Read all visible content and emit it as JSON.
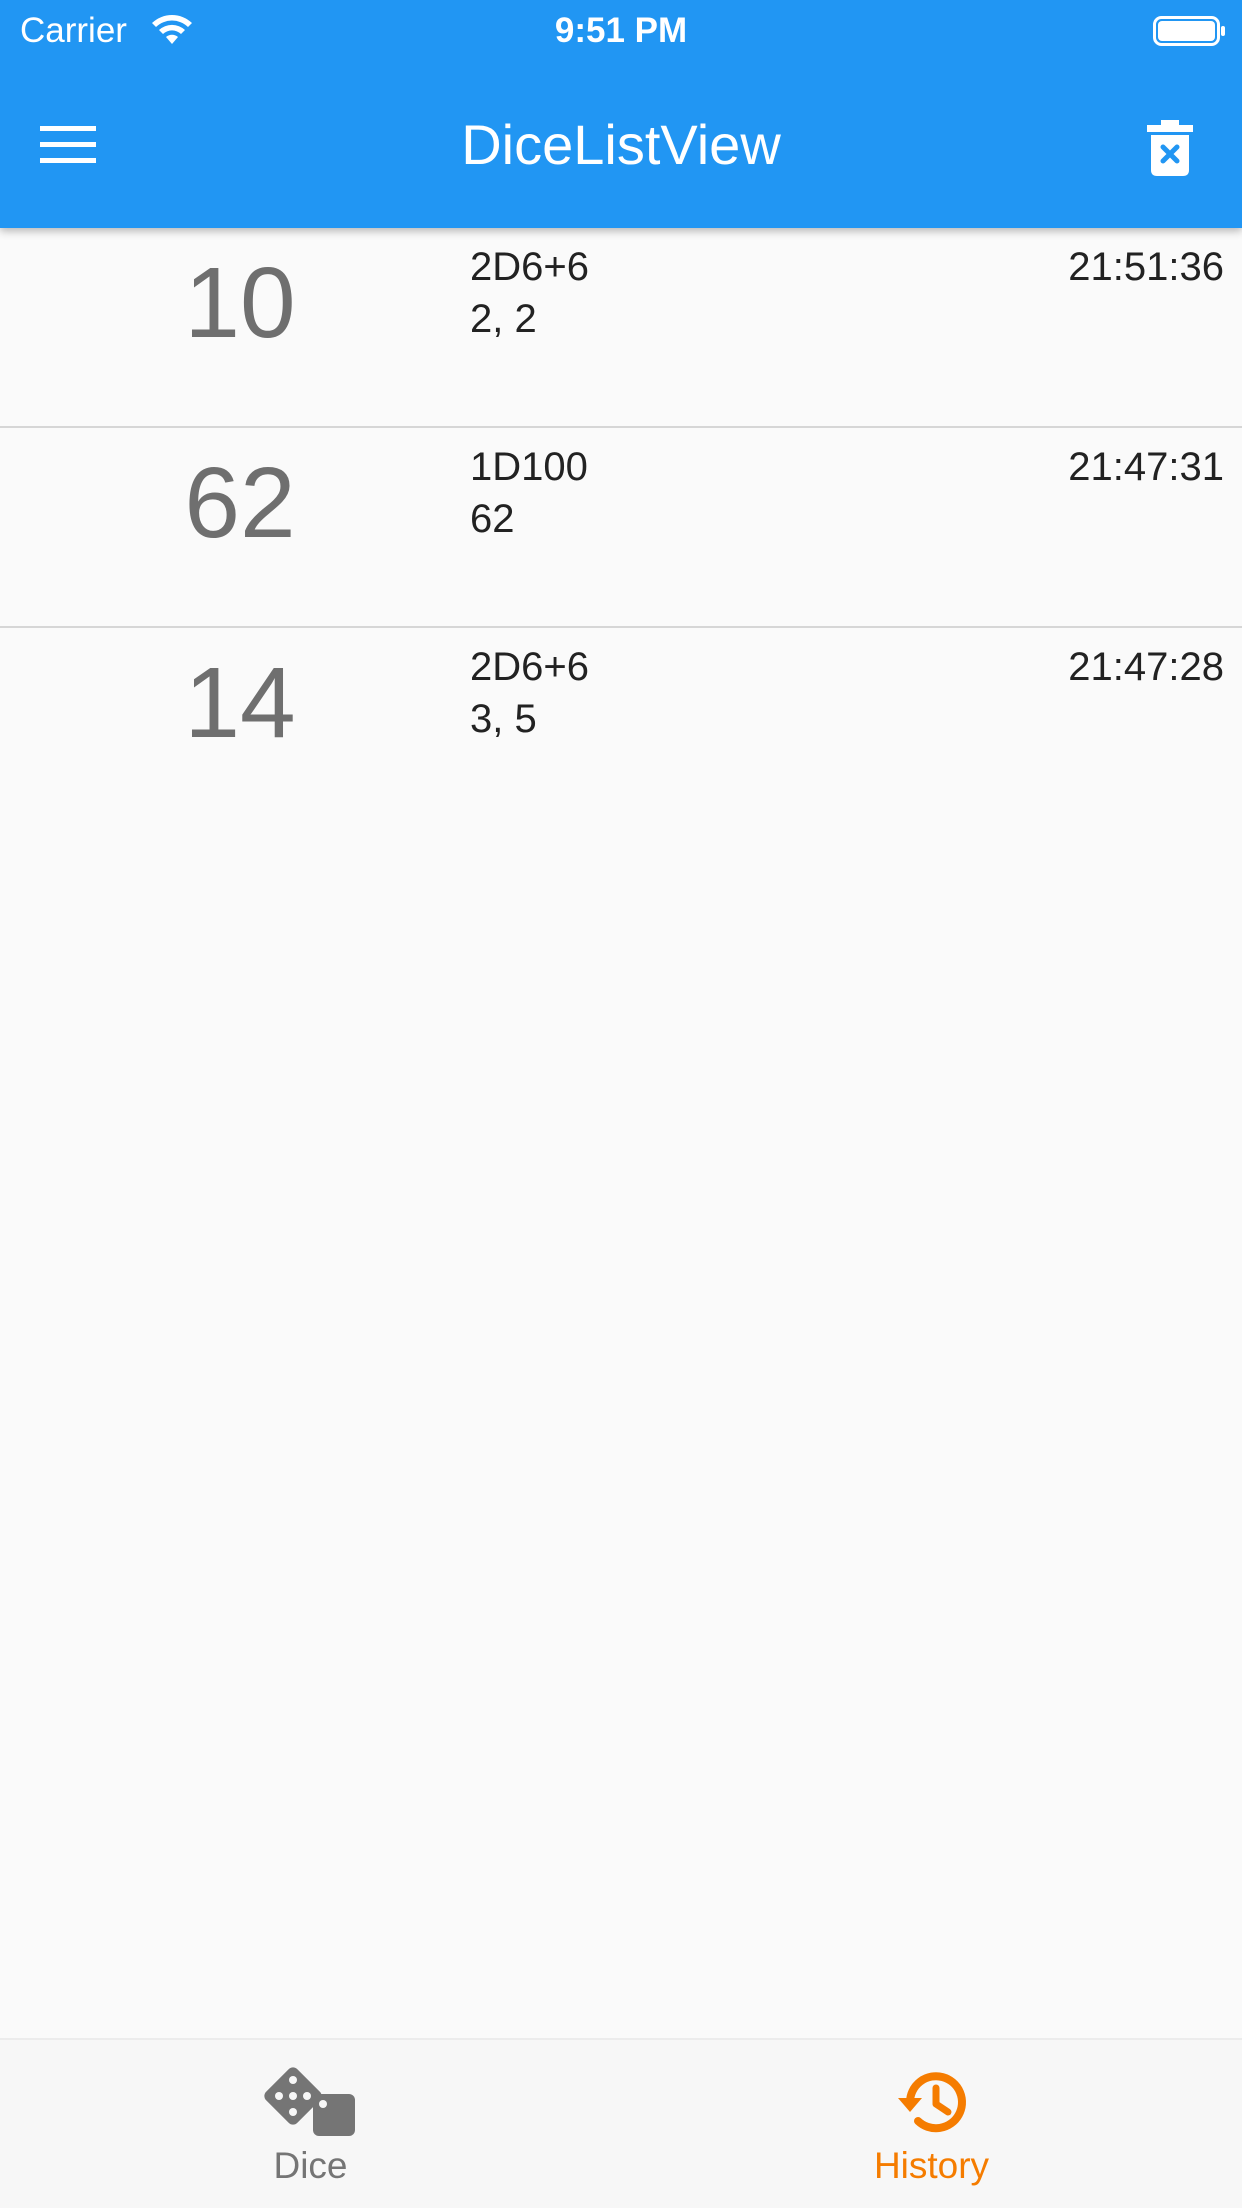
{
  "status_bar": {
    "carrier": "Carrier",
    "time": "9:51 PM"
  },
  "app_bar": {
    "title": "DiceListView",
    "menu_icon": "hamburger-menu-icon",
    "action_icon": "delete-trash-icon"
  },
  "history": [
    {
      "total": "10",
      "expression": "2D6+6",
      "rolls": "2, 2",
      "time": "21:51:36"
    },
    {
      "total": "62",
      "expression": "1D100",
      "rolls": "62",
      "time": "21:47:31"
    },
    {
      "total": "14",
      "expression": "2D6+6",
      "rolls": "3, 5",
      "time": "21:47:28"
    }
  ],
  "bottom_nav": {
    "items": [
      {
        "label": "Dice",
        "icon": "dice-icon",
        "active": false
      },
      {
        "label": "History",
        "icon": "history-icon",
        "active": true
      }
    ]
  },
  "colors": {
    "app_bar": "#2196f3",
    "active_tab": "#f57c00",
    "inactive_tab": "#757575",
    "background": "#fafafa"
  }
}
